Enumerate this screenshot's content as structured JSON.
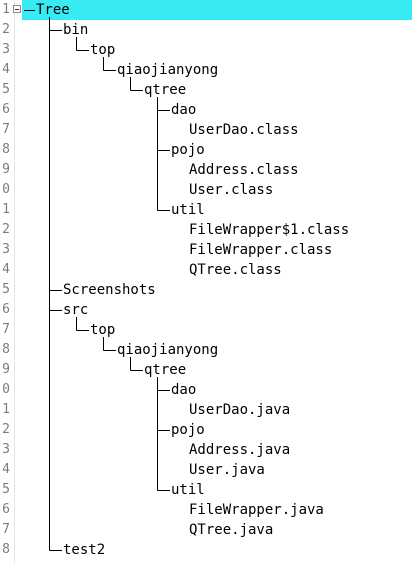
{
  "editor": {
    "lines": [
      {
        "num": "1",
        "text": "Tree",
        "depth": 0
      },
      {
        "num": "2",
        "text": "bin",
        "depth": 1
      },
      {
        "num": "3",
        "text": "top",
        "depth": 2
      },
      {
        "num": "4",
        "text": "qiaojianyong",
        "depth": 3
      },
      {
        "num": "5",
        "text": "qtree",
        "depth": 4
      },
      {
        "num": "6",
        "text": "dao",
        "depth": 5
      },
      {
        "num": "7",
        "text": "UserDao.class",
        "depth": 6
      },
      {
        "num": "8",
        "text": "pojo",
        "depth": 5
      },
      {
        "num": "9",
        "text": "Address.class",
        "depth": 6
      },
      {
        "num": "0",
        "text": "User.class",
        "depth": 6
      },
      {
        "num": "1",
        "text": "util",
        "depth": 5
      },
      {
        "num": "2",
        "text": "FileWrapper$1.class",
        "depth": 6
      },
      {
        "num": "3",
        "text": "FileWrapper.class",
        "depth": 6
      },
      {
        "num": "4",
        "text": "QTree.class",
        "depth": 6
      },
      {
        "num": "5",
        "text": "Screenshots",
        "depth": 1
      },
      {
        "num": "6",
        "text": "src",
        "depth": 1
      },
      {
        "num": "7",
        "text": "top",
        "depth": 2
      },
      {
        "num": "8",
        "text": "qiaojianyong",
        "depth": 3
      },
      {
        "num": "9",
        "text": "qtree",
        "depth": 4
      },
      {
        "num": "0",
        "text": "dao",
        "depth": 5
      },
      {
        "num": "1",
        "text": "UserDao.java",
        "depth": 6
      },
      {
        "num": "2",
        "text": "pojo",
        "depth": 5
      },
      {
        "num": "3",
        "text": "Address.java",
        "depth": 6
      },
      {
        "num": "4",
        "text": "User.java",
        "depth": 6
      },
      {
        "num": "5",
        "text": "util",
        "depth": 5
      },
      {
        "num": "6",
        "text": "FileWrapper.java",
        "depth": 6
      },
      {
        "num": "7",
        "text": "QTree.java",
        "depth": 6
      },
      {
        "num": "8",
        "text": "test2",
        "depth": 1
      }
    ]
  },
  "colors": {
    "current_line_highlight": "#38eaf2",
    "tree_line": "#000000",
    "line_number": "#7c7c7c"
  }
}
